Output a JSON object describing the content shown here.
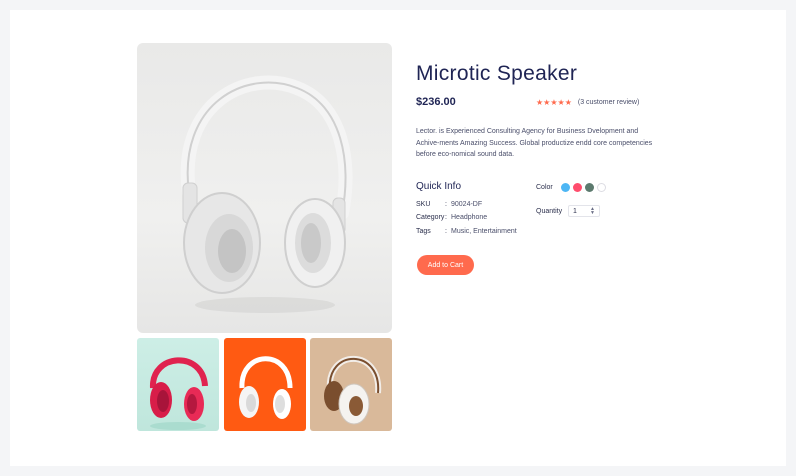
{
  "product": {
    "title": "Microtic Speaker",
    "price": "$236.00",
    "rating": {
      "stars": "★★★★★",
      "review_text": "(3 customer review)",
      "star_color": "#ff6a4d"
    },
    "description": "Lector. is Experienced Consulting Agency for Business Dvelopment and Achive-ments Amazing Success. Global productize endd core competencies before eco-nomical sound data."
  },
  "quick_info": {
    "title": "Quick Info",
    "rows": [
      {
        "label": "SKU",
        "sep": ":",
        "value": "90024-DF"
      },
      {
        "label": "Category",
        "sep": ":",
        "value": "Headphone"
      },
      {
        "label": "Tags",
        "sep": ":",
        "value": "Music, Entertainment"
      }
    ]
  },
  "options": {
    "color_label": "Color",
    "colors": [
      "#4db6f4",
      "#ff4d6d",
      "#5c7a6e",
      "#ffffff"
    ],
    "quantity_label": "Quantity",
    "quantity_value": "1"
  },
  "cart": {
    "add_label": "Add to Cart",
    "accent": "#ff6a4d"
  },
  "gallery": {
    "main_image": "white-headphones",
    "thumbnails": [
      "pink-headphones",
      "white-headphones-orange-bg",
      "brown-white-headphones"
    ],
    "thumb_colors": [
      "#c9ede3",
      "#ff5a12",
      "#d9b99a"
    ]
  }
}
